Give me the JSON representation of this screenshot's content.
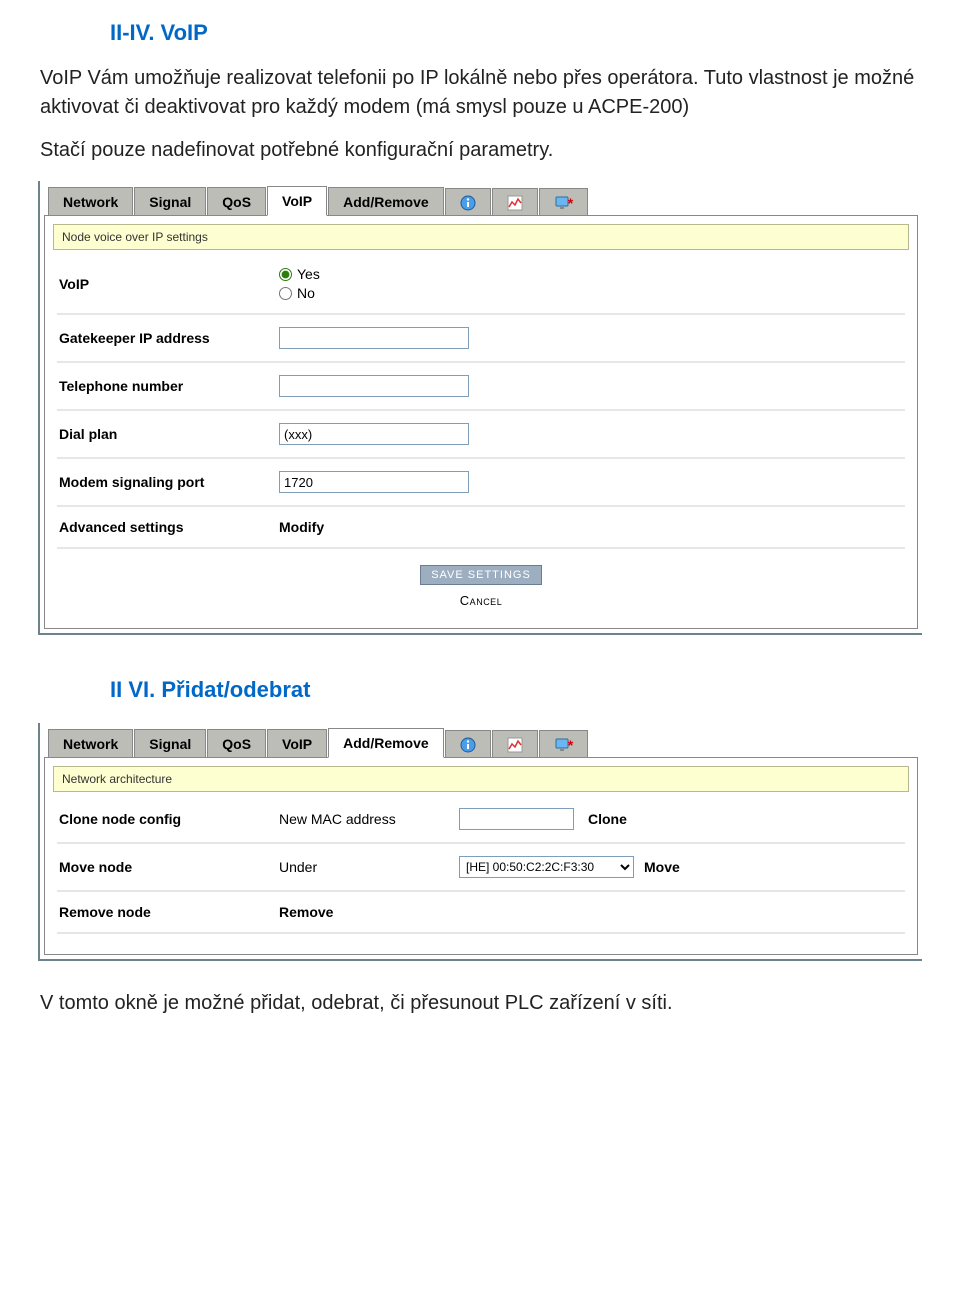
{
  "headings": {
    "voip": "II-IV. VoIP",
    "addremove": "II VI. Přidat/odebrat"
  },
  "paragraphs": {
    "voip_intro": "VoIP Vám umožňuje realizovat telefonii po IP lokálně nebo přes operátora. Tuto vlastnost je možné aktivovat či deaktivovat pro každý modem (má smysl pouze u ACPE-200)",
    "voip_stac": "Stačí pouze nadefinovat potřebné konfigurační parametry.",
    "addremove_desc": "V tomto okně je možné přidat, odebrat, či přesunout PLC zařízení v síti."
  },
  "tabs": {
    "network": "Network",
    "signal": "Signal",
    "qos": "QoS",
    "voip": "VoIP",
    "addremove": "Add/Remove"
  },
  "voip_panel": {
    "banner": "Node voice over IP settings",
    "labels": {
      "voip": "VoIP",
      "yes": "Yes",
      "no": "No",
      "gatekeeper": "Gatekeeper IP address",
      "telephone": "Telephone number",
      "dialplan": "Dial plan",
      "modemport": "Modem signaling port",
      "advanced": "Advanced settings",
      "modify": "Modify"
    },
    "values": {
      "dialplan": "(xxx)",
      "modemport": "1720"
    },
    "buttons": {
      "save": "SAVE SETTINGS",
      "cancel": "Cancel"
    }
  },
  "addremove_panel": {
    "banner": "Network architecture",
    "labels": {
      "clone": "Clone node config",
      "newmac": "New MAC address",
      "clone_action": "Clone",
      "move": "Move node",
      "under": "Under",
      "move_action": "Move",
      "remove": "Remove node",
      "remove_action": "Remove"
    },
    "values": {
      "he_option": "[HE] 00:50:C2:2C:F3:30"
    }
  }
}
